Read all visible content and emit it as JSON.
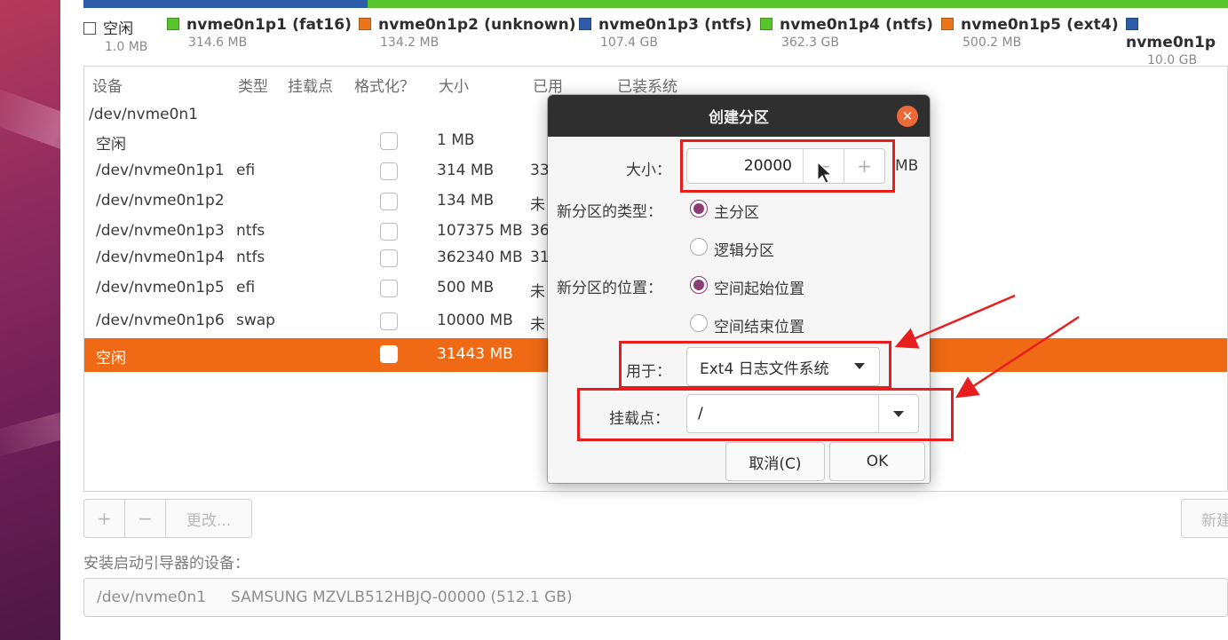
{
  "legend": [
    {
      "name": "空闲",
      "size": "1.0 MB",
      "color": "free"
    },
    {
      "name": "nvme0n1p1 (fat16)",
      "size": "314.6 MB",
      "color": "green"
    },
    {
      "name": "nvme0n1p2 (unknown)",
      "size": "134.2 MB",
      "color": "orange"
    },
    {
      "name": "nvme0n1p3 (ntfs)",
      "size": "107.4 GB",
      "color": "blue"
    },
    {
      "name": "nvme0n1p4 (ntfs)",
      "size": "362.3 GB",
      "color": "green"
    },
    {
      "name": "nvme0n1p5 (ext4)",
      "size": "500.2 MB",
      "color": "orange"
    },
    {
      "name": "nvme0n1p",
      "size": "10.0 GB",
      "color": "blue"
    }
  ],
  "table": {
    "headers": [
      "设备",
      "类型",
      "挂载点",
      "格式化？",
      "大小",
      "已用",
      "已装系统"
    ],
    "disk": "/dev/nvme0n1",
    "rows": [
      {
        "device": "空闲",
        "type": "",
        "size": "1 MB",
        "used": ""
      },
      {
        "device": "/dev/nvme0n1p1",
        "type": "efi",
        "size": "314 MB",
        "used": "33"
      },
      {
        "device": "/dev/nvme0n1p2",
        "type": "",
        "size": "134 MB",
        "used": "未"
      },
      {
        "device": "/dev/nvme0n1p3",
        "type": "ntfs",
        "size": "107375 MB",
        "used": "36"
      },
      {
        "device": "/dev/nvme0n1p4",
        "type": "ntfs",
        "size": "362340 MB",
        "used": "31"
      },
      {
        "device": "/dev/nvme0n1p5",
        "type": "efi",
        "size": "500 MB",
        "used": "未"
      },
      {
        "device": "/dev/nvme0n1p6",
        "type": "swap",
        "size": "10000 MB",
        "used": "未"
      },
      {
        "device": "空闲",
        "type": "",
        "size": "31443 MB",
        "used": ""
      }
    ]
  },
  "buttons": {
    "add": "+",
    "remove": "−",
    "change": "更改...",
    "new_table": "新建"
  },
  "boot": {
    "label": "安装启动引导器的设备：",
    "device": "/dev/nvme0n1",
    "model": "SAMSUNG MZVLB512HBJQ-00000 (512.1 GB)"
  },
  "dialog": {
    "title": "创建分区",
    "size_label": "大小：",
    "size_value": "20000",
    "size_unit": "MB",
    "type_label": "新分区的类型：",
    "type_primary": "主分区",
    "type_logical": "逻辑分区",
    "location_label": "新分区的位置：",
    "location_start": "空间起始位置",
    "location_end": "空间结束位置",
    "use_label": "用于：",
    "use_value": "Ext4 日志文件系统",
    "mount_label": "挂载点：",
    "mount_value": "/",
    "cancel": "取消(C)",
    "ok": "OK"
  },
  "colors": {
    "accent": "#f06a16",
    "radio": "#8d3b73",
    "annotation": "#e81e1e",
    "title_bar": "#2f2f2f"
  }
}
